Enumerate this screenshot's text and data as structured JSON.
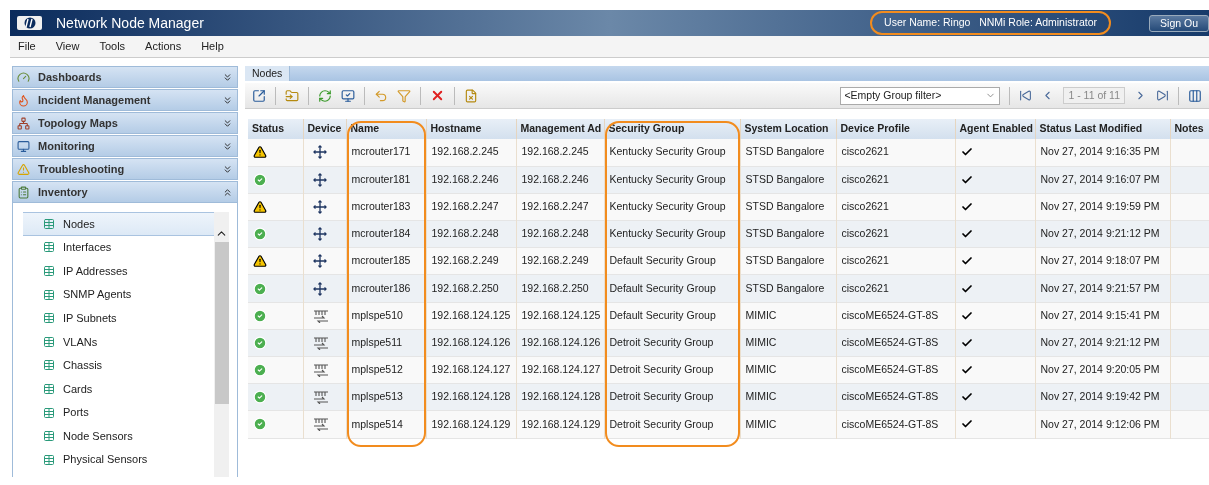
{
  "window": {
    "title": "Network Node Manager",
    "user_info": {
      "text": "User Name: Ringo   NNMi Role: Administrator",
      "highlighted": true
    },
    "sign_out": "Sign Ou"
  },
  "menu": [
    "File",
    "View",
    "Tools",
    "Actions",
    "Help"
  ],
  "sidebar": {
    "sections": [
      {
        "label": "Dashboards",
        "expanded": false
      },
      {
        "label": "Incident Management",
        "expanded": false
      },
      {
        "label": "Topology Maps",
        "expanded": false
      },
      {
        "label": "Monitoring",
        "expanded": false
      },
      {
        "label": "Troubleshooting",
        "expanded": false
      },
      {
        "label": "Inventory",
        "expanded": true,
        "items": [
          {
            "label": "Nodes",
            "selected": true
          },
          {
            "label": "Interfaces",
            "selected": false
          },
          {
            "label": "IP Addresses",
            "selected": false
          },
          {
            "label": "SNMP Agents",
            "selected": false
          },
          {
            "label": "IP Subnets",
            "selected": false
          },
          {
            "label": "VLANs",
            "selected": false
          },
          {
            "label": "Chassis",
            "selected": false
          },
          {
            "label": "Cards",
            "selected": false
          },
          {
            "label": "Ports",
            "selected": false
          },
          {
            "label": "Node Sensors",
            "selected": false
          },
          {
            "label": "Physical Sensors",
            "selected": false
          }
        ]
      }
    ]
  },
  "tab": "Nodes",
  "toolbar": {
    "filter_value": "<Empty Group filter>",
    "page_range": "1 - 11 of 11"
  },
  "table": {
    "columns": [
      {
        "label": "Status",
        "highlighted": false
      },
      {
        "label": "Device",
        "highlighted": false
      },
      {
        "label": "Name",
        "highlighted": true
      },
      {
        "label": "Hostname",
        "highlighted": false
      },
      {
        "label": "Management Ad",
        "highlighted": false
      },
      {
        "label": "Security Group",
        "highlighted": true
      },
      {
        "label": "System Location",
        "highlighted": false
      },
      {
        "label": "Device Profile",
        "highlighted": false
      },
      {
        "label": "Agent Enabled",
        "highlighted": false
      },
      {
        "label": "Status Last Modified",
        "highlighted": false
      },
      {
        "label": "Notes",
        "highlighted": false
      }
    ],
    "rows": [
      {
        "warning": true,
        "kind": "router",
        "name": "mcrouter171",
        "hostname": "192.168.2.245",
        "management_address": "192.168.2.245",
        "security_group": "Kentucky Security Group",
        "system_location": "STSD Bangalore",
        "device_profile": "cisco2621",
        "agent_enabled": true,
        "status_last_modified": "Nov 27, 2014 9:16:35 PM"
      },
      {
        "warning": false,
        "kind": "router",
        "name": "mcrouter181",
        "hostname": "192.168.2.246",
        "management_address": "192.168.2.246",
        "security_group": "Kentucky Security Group",
        "system_location": "STSD Bangalore",
        "device_profile": "cisco2621",
        "agent_enabled": true,
        "status_last_modified": "Nov 27, 2014 9:16:07 PM"
      },
      {
        "warning": true,
        "kind": "router",
        "name": "mcrouter183",
        "hostname": "192.168.2.247",
        "management_address": "192.168.2.247",
        "security_group": "Kentucky Security Group",
        "system_location": "STSD Bangalore",
        "device_profile": "cisco2621",
        "agent_enabled": true,
        "status_last_modified": "Nov 27, 2014 9:19:59 PM"
      },
      {
        "warning": false,
        "kind": "router",
        "name": "mcrouter184",
        "hostname": "192.168.2.248",
        "management_address": "192.168.2.248",
        "security_group": "Kentucky Security Group",
        "system_location": "STSD Bangalore",
        "device_profile": "cisco2621",
        "agent_enabled": true,
        "status_last_modified": "Nov 27, 2014 9:21:12 PM"
      },
      {
        "warning": true,
        "kind": "router",
        "name": "mcrouter185",
        "hostname": "192.168.2.249",
        "management_address": "192.168.2.249",
        "security_group": "Default Security Group",
        "system_location": "STSD Bangalore",
        "device_profile": "cisco2621",
        "agent_enabled": true,
        "status_last_modified": "Nov 27, 2014 9:18:07 PM"
      },
      {
        "warning": false,
        "kind": "router",
        "name": "mcrouter186",
        "hostname": "192.168.2.250",
        "management_address": "192.168.2.250",
        "security_group": "Default Security Group",
        "system_location": "STSD Bangalore",
        "device_profile": "cisco2621",
        "agent_enabled": true,
        "status_last_modified": "Nov 27, 2014 9:21:57 PM"
      },
      {
        "warning": false,
        "kind": "switch",
        "name": "mplspe510",
        "hostname": "192.168.124.125",
        "management_address": "192.168.124.125",
        "security_group": "Default Security Group",
        "system_location": "MIMIC",
        "device_profile": "ciscoME6524-GT-8S",
        "agent_enabled": true,
        "status_last_modified": "Nov 27, 2014 9:15:41 PM"
      },
      {
        "warning": false,
        "kind": "switch",
        "name": "mplspe511",
        "hostname": "192.168.124.126",
        "management_address": "192.168.124.126",
        "security_group": "Detroit Security Group",
        "system_location": "MIMIC",
        "device_profile": "ciscoME6524-GT-8S",
        "agent_enabled": true,
        "status_last_modified": "Nov 27, 2014 9:21:12 PM"
      },
      {
        "warning": false,
        "kind": "switch",
        "name": "mplspe512",
        "hostname": "192.168.124.127",
        "management_address": "192.168.124.127",
        "security_group": "Detroit Security Group",
        "system_location": "MIMIC",
        "device_profile": "ciscoME6524-GT-8S",
        "agent_enabled": true,
        "status_last_modified": "Nov 27, 2014 9:20:05 PM"
      },
      {
        "warning": false,
        "kind": "switch",
        "name": "mplspe513",
        "hostname": "192.168.124.128",
        "management_address": "192.168.124.128",
        "security_group": "Detroit Security Group",
        "system_location": "MIMIC",
        "device_profile": "ciscoME6524-GT-8S",
        "agent_enabled": true,
        "status_last_modified": "Nov 27, 2014 9:19:42 PM"
      },
      {
        "warning": false,
        "kind": "switch",
        "name": "mplspe514",
        "hostname": "192.168.124.129",
        "management_address": "192.168.124.129",
        "security_group": "Detroit Security Group",
        "system_location": "MIMIC",
        "device_profile": "ciscoME6524-GT-8S",
        "agent_enabled": true,
        "status_last_modified": "Nov 27, 2014 9:12:06 PM"
      }
    ]
  }
}
